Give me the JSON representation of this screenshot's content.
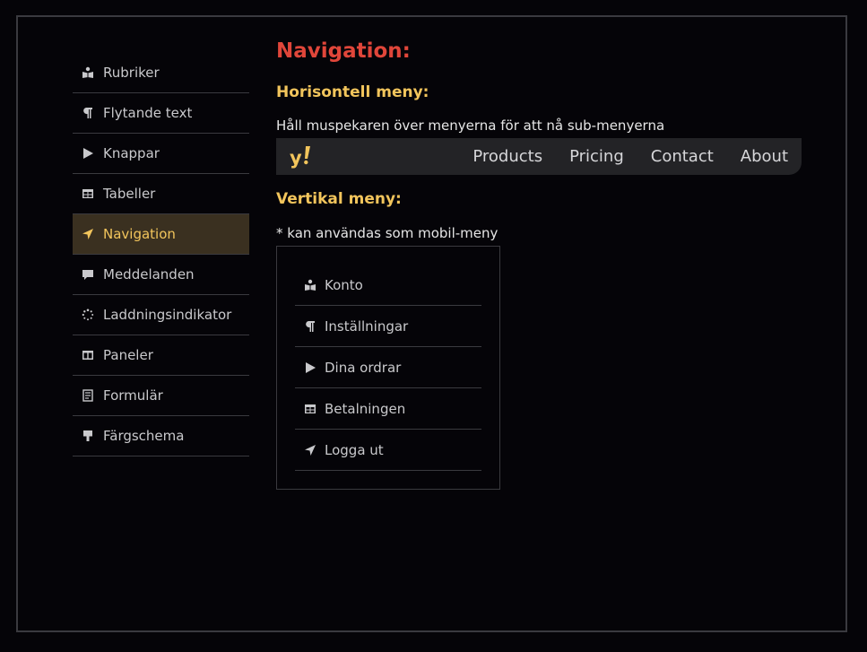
{
  "sidebar": {
    "items": [
      {
        "label": "Rubriker",
        "icon": "book-reader-icon"
      },
      {
        "label": "Flytande text",
        "icon": "paragraph-icon"
      },
      {
        "label": "Knappar",
        "icon": "play-icon"
      },
      {
        "label": "Tabeller",
        "icon": "table-icon"
      },
      {
        "label": "Navigation",
        "icon": "location-arrow-icon",
        "active": true
      },
      {
        "label": "Meddelanden",
        "icon": "comment-icon"
      },
      {
        "label": "Laddningsindikator",
        "icon": "spinner-icon"
      },
      {
        "label": "Paneler",
        "icon": "columns-icon"
      },
      {
        "label": "Formulär",
        "icon": "form-icon"
      },
      {
        "label": "Färgschema",
        "icon": "paint-roller-icon"
      }
    ]
  },
  "main": {
    "title": "Navigation:",
    "horizontal_heading": "Horisontell meny:",
    "hover_note": "Håll muspekaren över menyerna för att nå sub-menyerna",
    "hnav": {
      "logo_icon": "yahoo-logo-icon",
      "links": [
        "Products",
        "Pricing",
        "Contact",
        "About"
      ]
    },
    "vertical_heading": "Vertikal meny:",
    "mobile_note": "* kan användas som mobil-meny",
    "vmenu": {
      "items": [
        {
          "label": "Konto",
          "icon": "book-reader-icon"
        },
        {
          "label": "Inställningar",
          "icon": "paragraph-icon"
        },
        {
          "label": "Dina ordrar",
          "icon": "play-icon"
        },
        {
          "label": "Betalningen",
          "icon": "table-icon"
        },
        {
          "label": "Logga ut",
          "icon": "location-arrow-icon"
        }
      ]
    }
  },
  "colors": {
    "background": "#050408",
    "title_red": "#e0463a",
    "accent_yellow": "#f2c55c",
    "active_bg": "#3a3020",
    "nav_bar": "#232326"
  }
}
